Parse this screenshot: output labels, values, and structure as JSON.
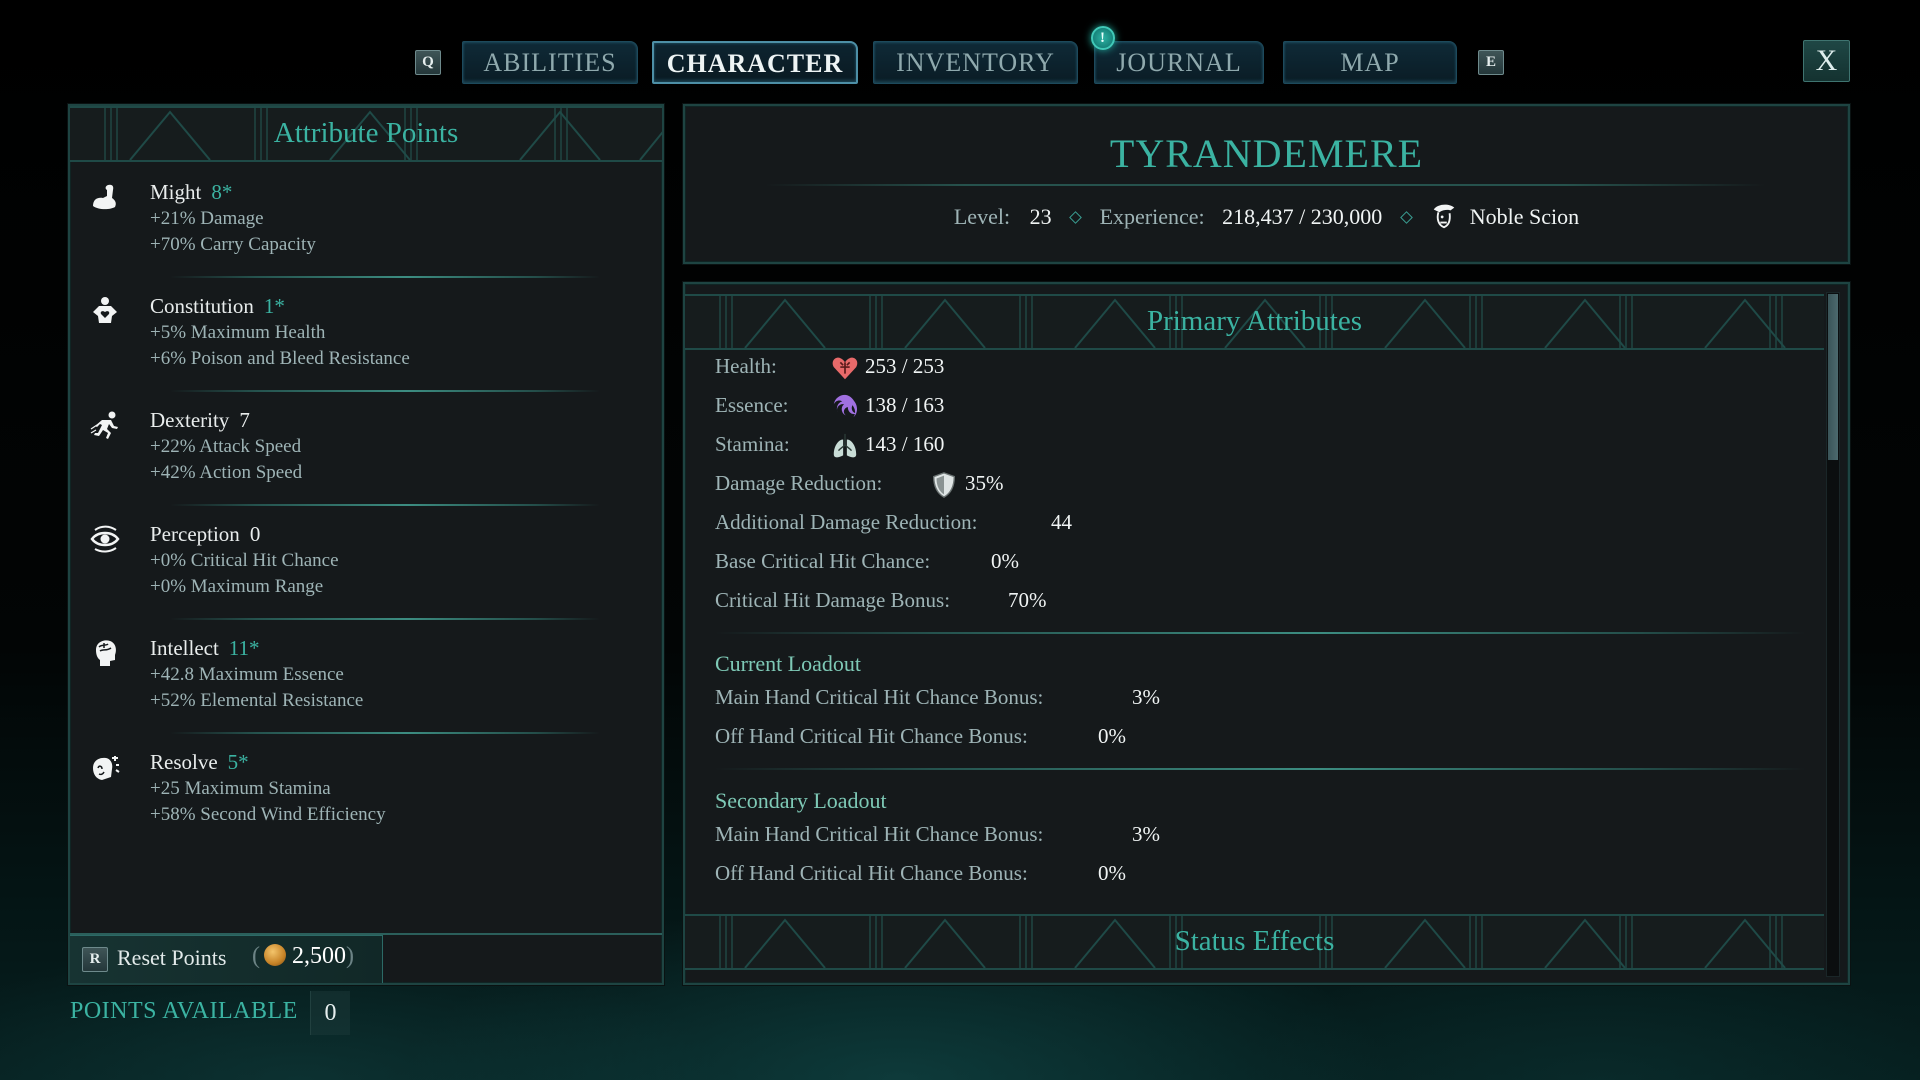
{
  "nav": {
    "prev_key": "Q",
    "next_key": "E",
    "close_label": "X",
    "notification_glyph": "!",
    "tabs": [
      {
        "label": "ABILITIES",
        "active": false
      },
      {
        "label": "CHARACTER",
        "active": true
      },
      {
        "label": "INVENTORY",
        "active": false
      },
      {
        "label": "JOURNAL",
        "active": false,
        "notification": true
      },
      {
        "label": "MAP",
        "active": false
      }
    ]
  },
  "attributes_panel": {
    "title": "Attribute Points",
    "attributes": [
      {
        "name": "Might",
        "value": "8*",
        "bonus": true,
        "icon": "flexed-arm-icon",
        "effects": [
          "+21% Damage",
          "+70% Carry Capacity"
        ]
      },
      {
        "name": "Constitution",
        "value": "1*",
        "bonus": true,
        "icon": "heart-torso-icon",
        "effects": [
          "+5% Maximum Health",
          "+6% Poison and Bleed Resistance"
        ]
      },
      {
        "name": "Dexterity",
        "value": "7",
        "bonus": false,
        "icon": "running-figure-icon",
        "effects": [
          "+22% Attack Speed",
          "+42% Action Speed"
        ]
      },
      {
        "name": "Perception",
        "value": "0",
        "bonus": false,
        "icon": "eye-icon",
        "effects": [
          "+0% Critical Hit Chance",
          "+0% Maximum Range"
        ]
      },
      {
        "name": "Intellect",
        "value": "11*",
        "bonus": true,
        "icon": "brain-head-icon",
        "effects": [
          "+42.8 Maximum Essence",
          "+52% Elemental Resistance"
        ]
      },
      {
        "name": "Resolve",
        "value": "5*",
        "bonus": true,
        "icon": "determined-head-icon",
        "effects": [
          "+25 Maximum Stamina",
          "+58% Second Wind Efficiency"
        ]
      }
    ],
    "reset": {
      "key": "R",
      "label": "Reset Points",
      "cost": "2,500",
      "currency_icon": "gold-coin-icon"
    },
    "points_available_label": "POINTS AVAILABLE",
    "points_available_value": "0"
  },
  "character": {
    "name": "TYRANDEMERE",
    "level_label": "Level:",
    "level": "23",
    "experience_label": "Experience:",
    "experience": "218,437 / 230,000",
    "background": "Noble Scion"
  },
  "primary": {
    "title": "Primary Attributes",
    "stats": [
      {
        "label": "Health:",
        "value": "253 / 253",
        "icon": "heart-icon"
      },
      {
        "label": "Essence:",
        "value": "138 / 163",
        "icon": "essence-swirl-icon"
      },
      {
        "label": "Stamina:",
        "value": "143 / 160",
        "icon": "lungs-icon"
      },
      {
        "label": "Damage Reduction:",
        "value": "35%",
        "icon": "shield-icon"
      },
      {
        "label": "Additional Damage Reduction:",
        "value": "44"
      },
      {
        "label": "Base Critical Hit Chance:",
        "value": "0%"
      },
      {
        "label": "Critical Hit Damage Bonus:",
        "value": "70%"
      }
    ],
    "current_loadout": {
      "title": "Current Loadout",
      "rows": [
        {
          "label": "Main Hand Critical Hit Chance Bonus:",
          "value": "3%"
        },
        {
          "label": "Off Hand Critical Hit Chance Bonus:",
          "value": "0%"
        }
      ]
    },
    "secondary_loadout": {
      "title": "Secondary Loadout",
      "rows": [
        {
          "label": "Main Hand Critical Hit Chance Bonus:",
          "value": "3%"
        },
        {
          "label": "Off Hand Critical Hit Chance Bonus:",
          "value": "0%"
        }
      ]
    },
    "status_title": "Status Effects",
    "scroll_position": 0.0
  },
  "colors": {
    "accent": "#3bb3a2",
    "panel_bg": "#15191b",
    "label": "#9eb4b6",
    "value": "#f0f4f4"
  }
}
